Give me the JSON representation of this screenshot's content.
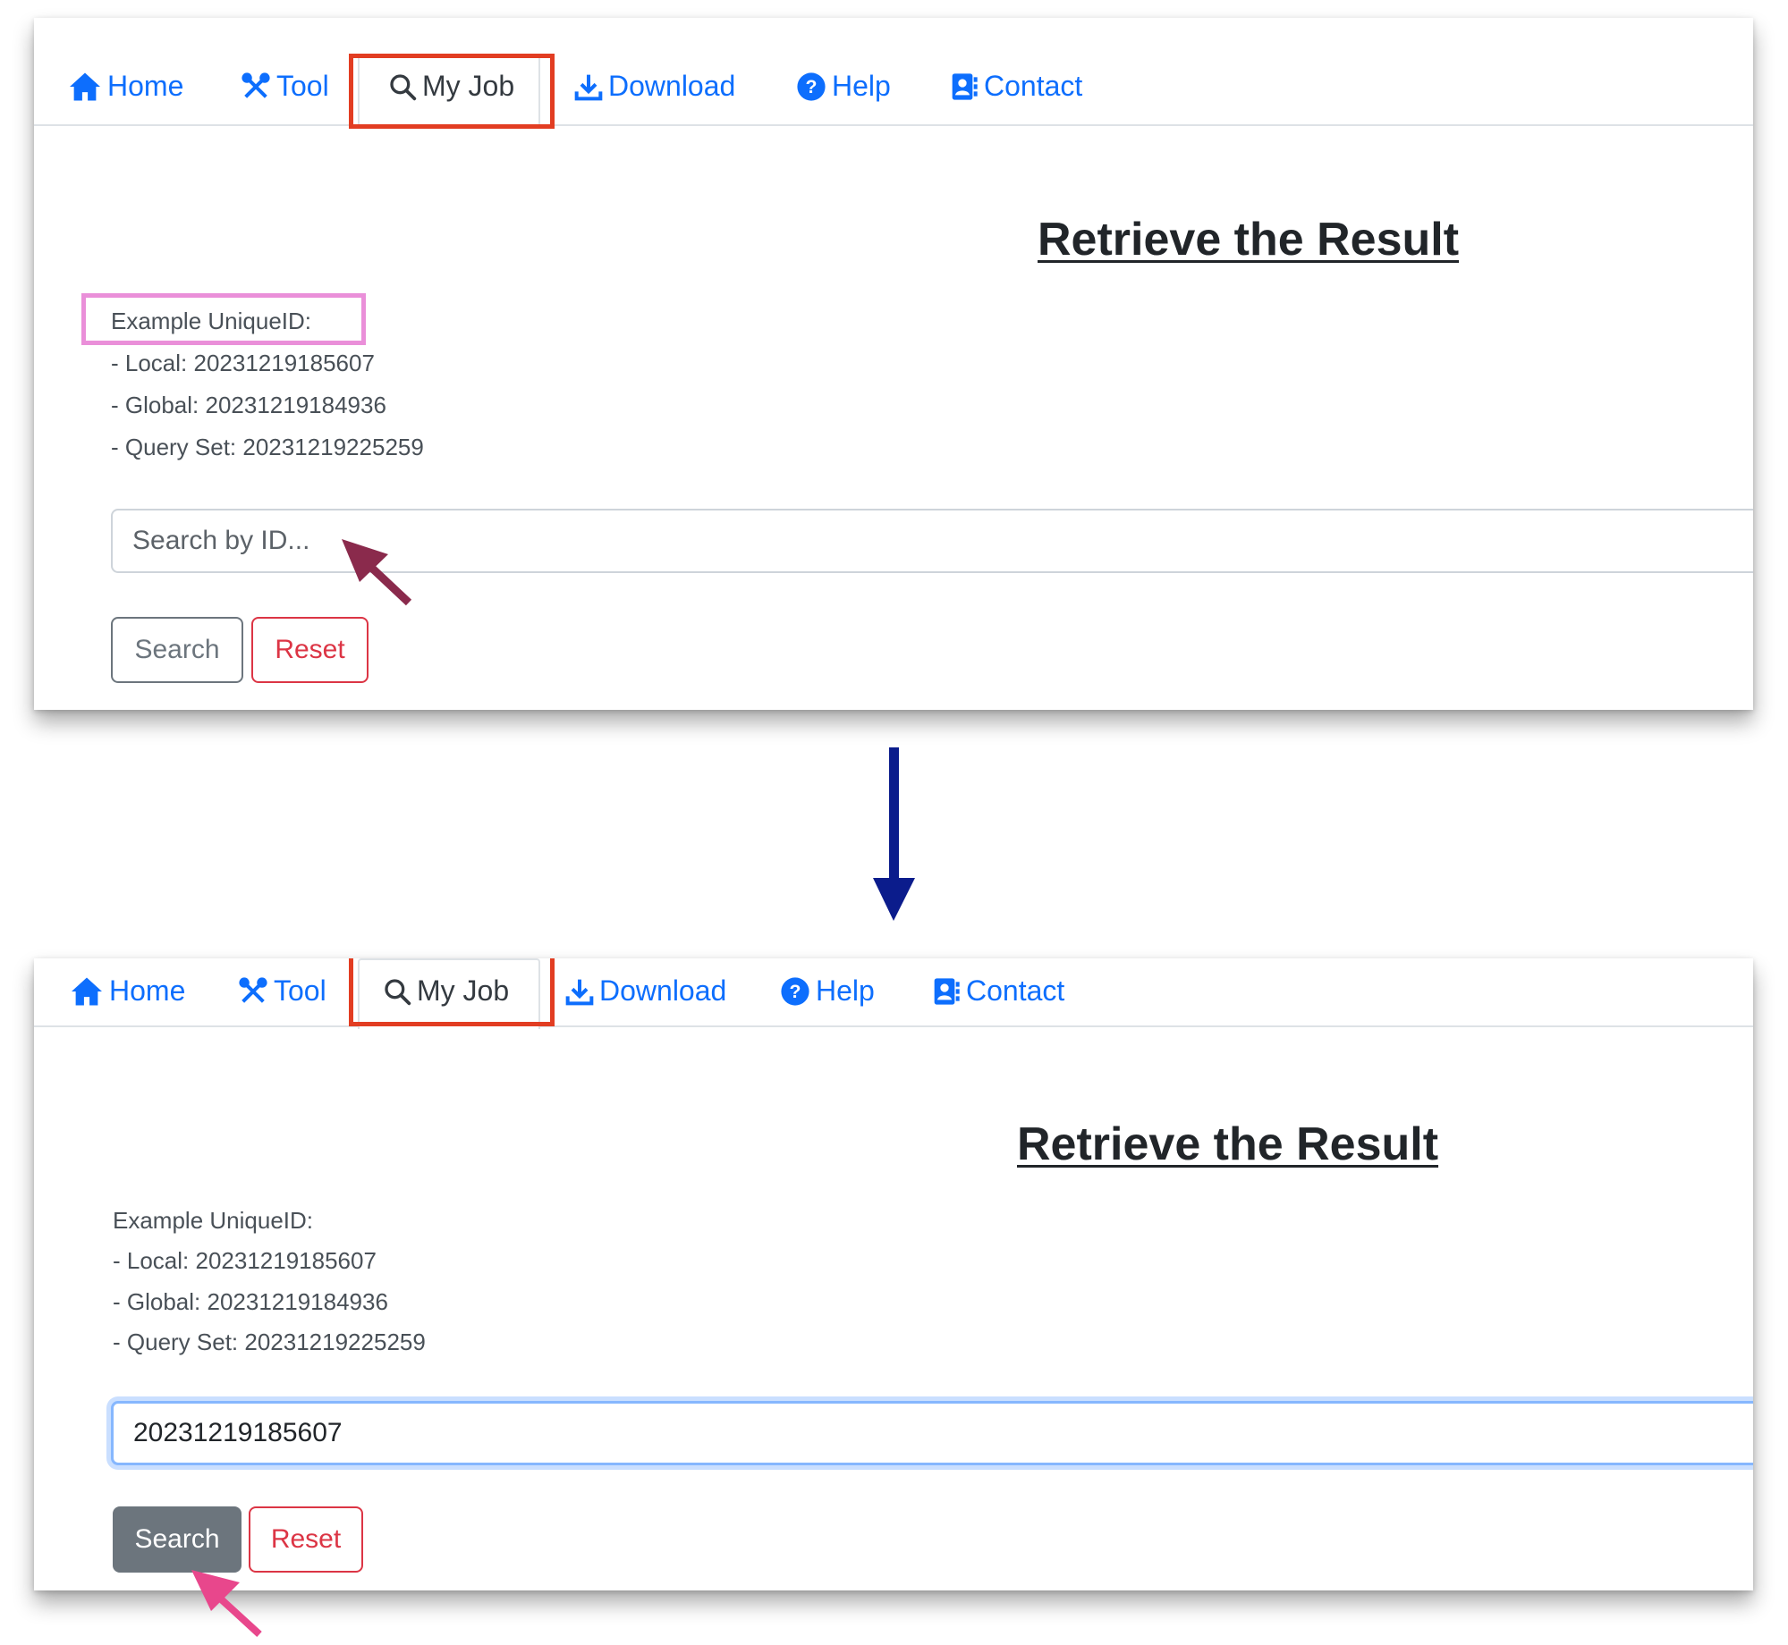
{
  "nav": {
    "home": "Home",
    "tool": "Tool",
    "my_job": "My Job",
    "download": "Download",
    "help": "Help",
    "contact": "Contact"
  },
  "page_title": "Retrieve the Result",
  "examples": {
    "heading": "Example UniqueID:",
    "local": "- Local: 20231219185607",
    "global": "- Global: 20231219184936",
    "query_set": "- Query Set: 20231219225259"
  },
  "search": {
    "placeholder": "Search by ID...",
    "filled_value": "20231219185607",
    "search_label": "Search",
    "reset_label": "Reset"
  },
  "colors": {
    "nav_link": "#0d6efd",
    "highlight_red": "#e23d22",
    "highlight_pink": "#ea8fd9",
    "arrow_maroon": "#8a2a4c",
    "arrow_pink": "#e8478c",
    "arrow_navy": "#0b1c8c"
  }
}
